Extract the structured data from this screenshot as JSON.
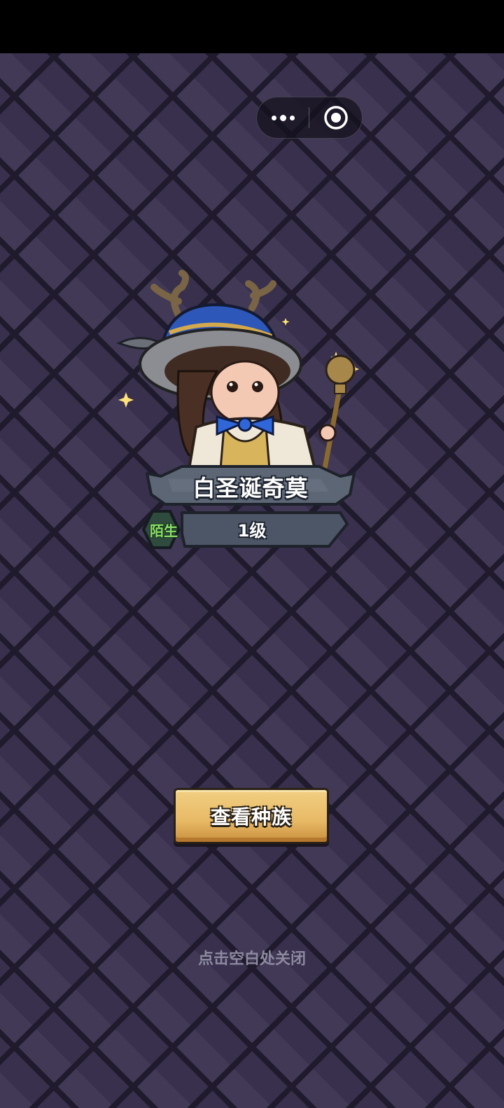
{
  "capsule": {
    "more_icon": "more-dots-icon",
    "close_icon": "target-close-icon"
  },
  "character": {
    "name": "白圣诞奇莫",
    "level": "1级",
    "relation": "陌生",
    "portrait_icon": "christmas-reindeer-mage-character"
  },
  "actions": {
    "view_race_label": "查看种族"
  },
  "hint": {
    "close_text": "点击空白处关闭"
  },
  "colors": {
    "background": "#3b3351",
    "grid_lines": "#1f1b2c",
    "button_gold": "#e7b966",
    "relation_green": "#8ee06a",
    "hint_text": "#8d8aa0"
  }
}
